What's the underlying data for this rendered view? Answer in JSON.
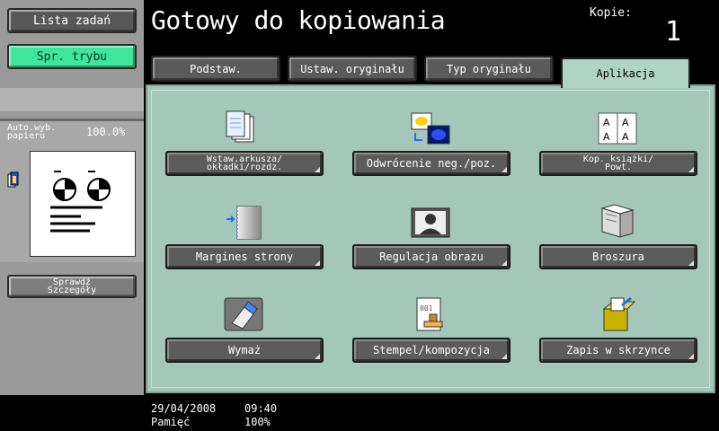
{
  "sidebar": {
    "jobs_label": "Lista zadań",
    "mode_label": "Spr. trybu",
    "paper_label": "Auto.wyb.\npapieru",
    "zoom": "100.0%",
    "details_label": "Sprawdź\nSzczegóły"
  },
  "header": {
    "title": "Gotowy do kopiowania",
    "copies_label": "Kopie:",
    "copies_value": "1"
  },
  "tabs": [
    {
      "label": "Podstaw."
    },
    {
      "label": "Ustaw. oryginału"
    },
    {
      "label": "Typ oryginału"
    },
    {
      "label": "Aplikacja",
      "active": true
    }
  ],
  "functions": [
    {
      "label": "Wstaw.arkusza/\nokładki/rozdz.",
      "icon": "sheet-insert-icon"
    },
    {
      "label": "Odwrócenie neg./poz.",
      "icon": "neg-pos-icon"
    },
    {
      "label": "Kop. książki/\nPowt.",
      "icon": "book-copy-icon"
    },
    {
      "label": "Margines strony",
      "icon": "page-margin-icon"
    },
    {
      "label": "Regulacja obrazu",
      "icon": "image-adjust-icon"
    },
    {
      "label": "Broszura",
      "icon": "booklet-icon"
    },
    {
      "label": "Wymaż",
      "icon": "erase-icon"
    },
    {
      "label": "Stempel/kompozycja",
      "icon": "stamp-icon"
    },
    {
      "label": "Zapis w skrzynce",
      "icon": "save-box-icon"
    }
  ],
  "status": {
    "date": "29/04/2008",
    "time": "09:40",
    "memory_label": "Pamięć",
    "memory_value": "100%"
  },
  "colors": {
    "panel_green": "#a4c7b9",
    "mode_button": "#3ee59a",
    "button_gray": "#5c5c5c"
  }
}
